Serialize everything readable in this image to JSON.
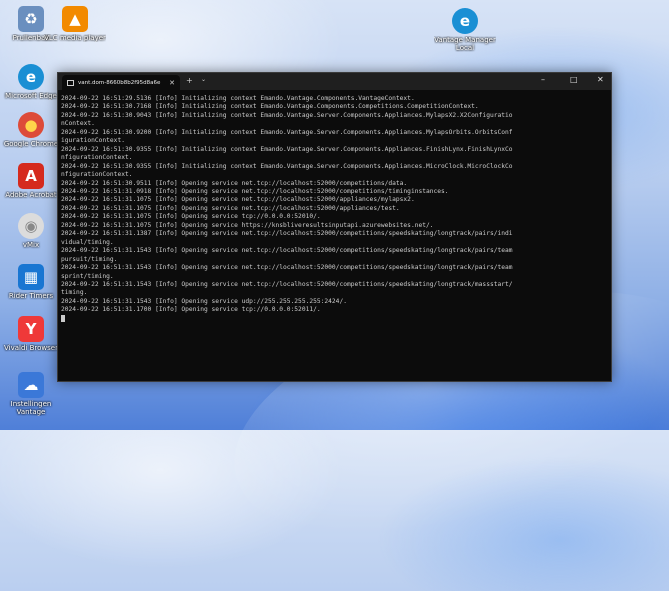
{
  "desktop": {
    "icons": [
      {
        "name": "recycle-bin-icon",
        "label": "Prullenbak",
        "color": "#6a8fbf",
        "glyph": "♻"
      },
      {
        "name": "vlc-icon",
        "label": "VLC media player",
        "color": "#f28a00",
        "glyph": "▲"
      },
      {
        "name": "edge-icon",
        "label": "Microsoft Edge",
        "color": "#1a8fd4",
        "glyph": "e"
      },
      {
        "name": "chrome-icon",
        "label": "Google Chrome",
        "color": "#dd4b39",
        "glyph": "●"
      },
      {
        "name": "acrobat-icon",
        "label": "Adobe Acrobat",
        "color": "#d52a1e",
        "glyph": "A"
      },
      {
        "name": "shared-edge-icon",
        "label": "Vantage Manager Local",
        "color": "#1a8fd4",
        "glyph": "e"
      },
      {
        "name": "vmix-icon",
        "label": "vMix",
        "color": "#dcdcdc",
        "glyph": "◉"
      },
      {
        "name": "calendar-icon",
        "label": "Rider Timers",
        "color": "#1976d2",
        "glyph": "▦"
      },
      {
        "name": "vivaldi-icon",
        "label": "Vivaldi Browser",
        "color": "#ef3939",
        "glyph": "Y"
      },
      {
        "name": "onedrive-icon",
        "label": "Instellingen Vantage",
        "color": "#3b78d8",
        "glyph": "☁"
      }
    ]
  },
  "terminal": {
    "tab_title": "vant.dom-8660b8b2f95d8a6e",
    "close_glyph": "✕",
    "newtab_glyph": "+",
    "dropdown_glyph": "⌄",
    "minimize_glyph": "–",
    "maximize_glyph": "□",
    "window_close_glyph": "✕",
    "lines": [
      "2024-09-22 16:51:29.5136 [Info] Initializing context Emando.Vantage.Components.VantageContext.",
      "2024-09-22 16:51:30.7168 [Info] Initializing context Emando.Vantage.Components.Competitions.CompetitionContext.",
      "2024-09-22 16:51:30.9043 [Info] Initializing context Emando.Vantage.Server.Components.Appliances.MylapsX2.X2Configuratio",
      "nContext.",
      "2024-09-22 16:51:30.9200 [Info] Initializing context Emando.Vantage.Server.Components.Appliances.MylapsOrbits.OrbitsConf",
      "igurationContext.",
      "2024-09-22 16:51:30.9355 [Info] Initializing context Emando.Vantage.Server.Components.Appliances.FinishLynx.FinishLynxCo",
      "nfigurationContext.",
      "2024-09-22 16:51:30.9355 [Info] Initializing context Emando.Vantage.Server.Components.Appliances.MicroClock.MicroClockCo",
      "nfigurationContext.",
      "2024-09-22 16:51:30.9511 [Info] Opening service net.tcp://localhost:52000/competitions/data.",
      "2024-09-22 16:51:31.0918 [Info] Opening service net.tcp://localhost:52000/competitions/timinginstances.",
      "2024-09-22 16:51:31.1075 [Info] Opening service net.tcp://localhost:52000/appliances/mylapsx2.",
      "2024-09-22 16:51:31.1075 [Info] Opening service net.tcp://localhost:52000/appliances/test.",
      "2024-09-22 16:51:31.1075 [Info] Opening service tcp://0.0.0.0:52010/.",
      "2024-09-22 16:51:31.1075 [Info] Opening service https://knsbliveresultsinputapi.azurewebsites.net/.",
      "2024-09-22 16:51:31.1387 [Info] Opening service net.tcp://localhost:52000/competitions/speedskating/longtrack/pairs/indi",
      "vidual/timing.",
      "2024-09-22 16:51:31.1543 [Info] Opening service net.tcp://localhost:52000/competitions/speedskating/longtrack/pairs/team",
      "pursuit/timing.",
      "2024-09-22 16:51:31.1543 [Info] Opening service net.tcp://localhost:52000/competitions/speedskating/longtrack/pairs/team",
      "sprint/timing.",
      "2024-09-22 16:51:31.1543 [Info] Opening service net.tcp://localhost:52000/competitions/speedskating/longtrack/massstart/",
      "timing.",
      "2024-09-22 16:51:31.1543 [Info] Opening service udp://255.255.255.255:2424/.",
      "2024-09-22 16:51:31.1700 [Info] Opening service tcp://0.0.0.0:52011/."
    ]
  }
}
